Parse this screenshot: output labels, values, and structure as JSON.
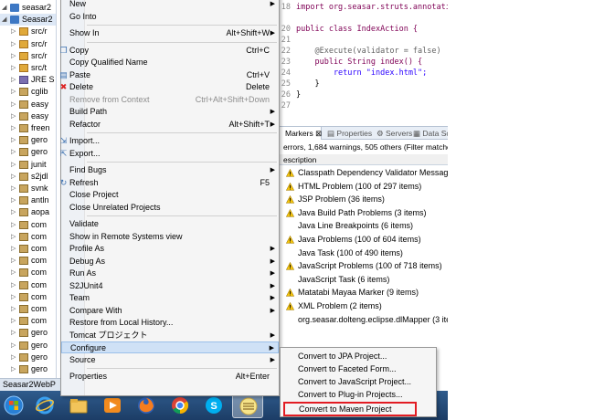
{
  "tree": {
    "items": [
      {
        "label": "seasar2",
        "icon": "project-icon"
      },
      {
        "label": "Seasar2",
        "icon": "project-icon"
      },
      {
        "label": "src/r",
        "icon": "source-folder-icon"
      },
      {
        "label": "src/r",
        "icon": "source-folder-icon"
      },
      {
        "label": "src/r",
        "icon": "source-folder-icon"
      },
      {
        "label": "src/t",
        "icon": "source-folder-icon"
      },
      {
        "label": "JRE S",
        "icon": "library-icon"
      },
      {
        "label": "cglib",
        "icon": "jar-icon"
      },
      {
        "label": "easy",
        "icon": "jar-icon"
      },
      {
        "label": "easy",
        "icon": "jar-icon"
      },
      {
        "label": "freen",
        "icon": "jar-icon"
      },
      {
        "label": "gero",
        "icon": "jar-icon"
      },
      {
        "label": "gero",
        "icon": "jar-icon"
      },
      {
        "label": "junit",
        "icon": "jar-icon"
      },
      {
        "label": "s2jdl",
        "icon": "jar-icon"
      },
      {
        "label": "svnk",
        "icon": "jar-icon"
      },
      {
        "label": "antln",
        "icon": "jar-icon"
      },
      {
        "label": "aopa",
        "icon": "jar-icon"
      },
      {
        "label": "com",
        "icon": "jar-icon"
      },
      {
        "label": "com",
        "icon": "jar-icon"
      },
      {
        "label": "com",
        "icon": "jar-icon"
      },
      {
        "label": "com",
        "icon": "jar-icon"
      },
      {
        "label": "com",
        "icon": "jar-icon"
      },
      {
        "label": "com",
        "icon": "jar-icon"
      },
      {
        "label": "com",
        "icon": "jar-icon"
      },
      {
        "label": "com",
        "icon": "jar-icon"
      },
      {
        "label": "com",
        "icon": "jar-icon"
      },
      {
        "label": "gero",
        "icon": "jar-icon"
      },
      {
        "label": "gero",
        "icon": "jar-icon"
      },
      {
        "label": "gero",
        "icon": "jar-icon"
      },
      {
        "label": "gero",
        "icon": "jar-icon"
      }
    ]
  },
  "editor": {
    "lines": [
      {
        "num": "18",
        "text": "import org.seasar.struts.annotation.E"
      },
      {
        "num": "",
        "text": ""
      },
      {
        "num": "20",
        "text": "public class IndexAction {"
      },
      {
        "num": "21",
        "text": ""
      },
      {
        "num": "22",
        "text": "    @Execute(validator = false)"
      },
      {
        "num": "23",
        "text": "    public String index() {"
      },
      {
        "num": "24",
        "text": "        return \"index.html\";"
      },
      {
        "num": "25",
        "text": "    }"
      },
      {
        "num": "26",
        "text": "}"
      },
      {
        "num": "27",
        "text": ""
      }
    ]
  },
  "markers": {
    "tabs": {
      "active": "Markers",
      "properties": "Properties",
      "servers": "Servers",
      "data_source": "Data Sc"
    },
    "summary": "errors, 1,684 warnings, 505 others (Filter matche",
    "column_header": "escription",
    "rows": [
      {
        "text": "Classpath Dependency Validator Message (1",
        "warn": true
      },
      {
        "text": "HTML Problem (100 of 297 items)",
        "warn": true
      },
      {
        "text": "JSP Problem (36 items)",
        "warn": true
      },
      {
        "text": "Java Build Path Problems (3 items)",
        "warn": true
      },
      {
        "text": "Java Line Breakpoints (6 items)",
        "warn": false
      },
      {
        "text": "Java Problems (100 of 604 items)",
        "warn": true
      },
      {
        "text": "Java Task (100 of 490 items)",
        "warn": false
      },
      {
        "text": "JavaScript Problems (100 of 718 items)",
        "warn": true
      },
      {
        "text": "JavaScript Task (6 items)",
        "warn": false
      },
      {
        "text": "Matatabi Mayaa Marker (9 items)",
        "warn": true
      },
      {
        "text": "XML Problem (2 items)",
        "warn": true
      },
      {
        "text": "org.seasar.dolteng.eclipse.dlMapper (3 item",
        "warn": false
      }
    ]
  },
  "context_menu": {
    "items": [
      {
        "label": "New",
        "shortcut": "",
        "submenu": true,
        "disabled": false
      },
      {
        "label": "Go Into",
        "shortcut": "",
        "submenu": false,
        "disabled": false
      },
      {
        "sep": true
      },
      {
        "label": "Show In",
        "shortcut": "Alt+Shift+W",
        "submenu": true,
        "disabled": false
      },
      {
        "sep": true
      },
      {
        "label": "Copy",
        "shortcut": "Ctrl+C",
        "submenu": false,
        "disabled": false,
        "icon": "copy-icon"
      },
      {
        "label": "Copy Qualified Name",
        "shortcut": "",
        "submenu": false,
        "disabled": false
      },
      {
        "label": "Paste",
        "shortcut": "Ctrl+V",
        "submenu": false,
        "disabled": false,
        "icon": "paste-icon"
      },
      {
        "label": "Delete",
        "shortcut": "Delete",
        "submenu": false,
        "disabled": false,
        "icon": "delete-icon"
      },
      {
        "label": "Remove from Context",
        "shortcut": "Ctrl+Alt+Shift+Down",
        "submenu": false,
        "disabled": true
      },
      {
        "label": "Build Path",
        "shortcut": "",
        "submenu": true,
        "disabled": false
      },
      {
        "label": "Refactor",
        "shortcut": "Alt+Shift+T",
        "submenu": true,
        "disabled": false
      },
      {
        "sep": true
      },
      {
        "label": "Import...",
        "shortcut": "",
        "submenu": false,
        "disabled": false,
        "icon": "import-icon"
      },
      {
        "label": "Export...",
        "shortcut": "",
        "submenu": false,
        "disabled": false,
        "icon": "export-icon"
      },
      {
        "sep": true
      },
      {
        "label": "Find Bugs",
        "shortcut": "",
        "submenu": true,
        "disabled": false
      },
      {
        "label": "Refresh",
        "shortcut": "F5",
        "submenu": false,
        "disabled": false,
        "icon": "refresh-icon"
      },
      {
        "label": "Close Project",
        "shortcut": "",
        "submenu": false,
        "disabled": false
      },
      {
        "label": "Close Unrelated Projects",
        "shortcut": "",
        "submenu": false,
        "disabled": false
      },
      {
        "sep": true
      },
      {
        "label": "Validate",
        "shortcut": "",
        "submenu": false,
        "disabled": false
      },
      {
        "label": "Show in Remote Systems view",
        "shortcut": "",
        "submenu": false,
        "disabled": false
      },
      {
        "label": "Profile As",
        "shortcut": "",
        "submenu": true,
        "disabled": false
      },
      {
        "label": "Debug As",
        "shortcut": "",
        "submenu": true,
        "disabled": false
      },
      {
        "label": "Run As",
        "shortcut": "",
        "submenu": true,
        "disabled": false
      },
      {
        "label": "S2JUnit4",
        "shortcut": "",
        "submenu": true,
        "disabled": false
      },
      {
        "label": "Team",
        "shortcut": "",
        "submenu": true,
        "disabled": false
      },
      {
        "label": "Compare With",
        "shortcut": "",
        "submenu": true,
        "disabled": false
      },
      {
        "label": "Restore from Local History...",
        "shortcut": "",
        "submenu": false,
        "disabled": false
      },
      {
        "label": "Tomcat プロジェクト",
        "shortcut": "",
        "submenu": true,
        "disabled": false
      },
      {
        "label": "Configure",
        "shortcut": "",
        "submenu": true,
        "disabled": false,
        "highlighted": true
      },
      {
        "label": "Source",
        "shortcut": "",
        "submenu": true,
        "disabled": false
      },
      {
        "sep": true
      },
      {
        "label": "Properties",
        "shortcut": "Alt+Enter",
        "submenu": false,
        "disabled": false
      }
    ]
  },
  "submenu": {
    "items": [
      {
        "label": "Convert to JPA Project..."
      },
      {
        "label": "Convert to Faceted Form..."
      },
      {
        "label": "Convert to JavaScript Project..."
      },
      {
        "label": "Convert to Plug-in Projects..."
      },
      {
        "label": "Convert to Maven Project",
        "outlined": true
      }
    ],
    "outline_color": "#e21c23"
  },
  "status_text": "Seasar2WebP",
  "taskbar": {
    "buttons": [
      "windows-start-icon",
      "internet-explorer-icon",
      "file-explorer-icon",
      "media-player-icon",
      "firefox-icon",
      "chrome-icon",
      "skype-icon",
      "eclipse-icon"
    ]
  },
  "colors": {
    "menu_highlight": "#cfe1f6",
    "taskbar": "#1c3d66",
    "highlight_border": "#e21c23"
  }
}
